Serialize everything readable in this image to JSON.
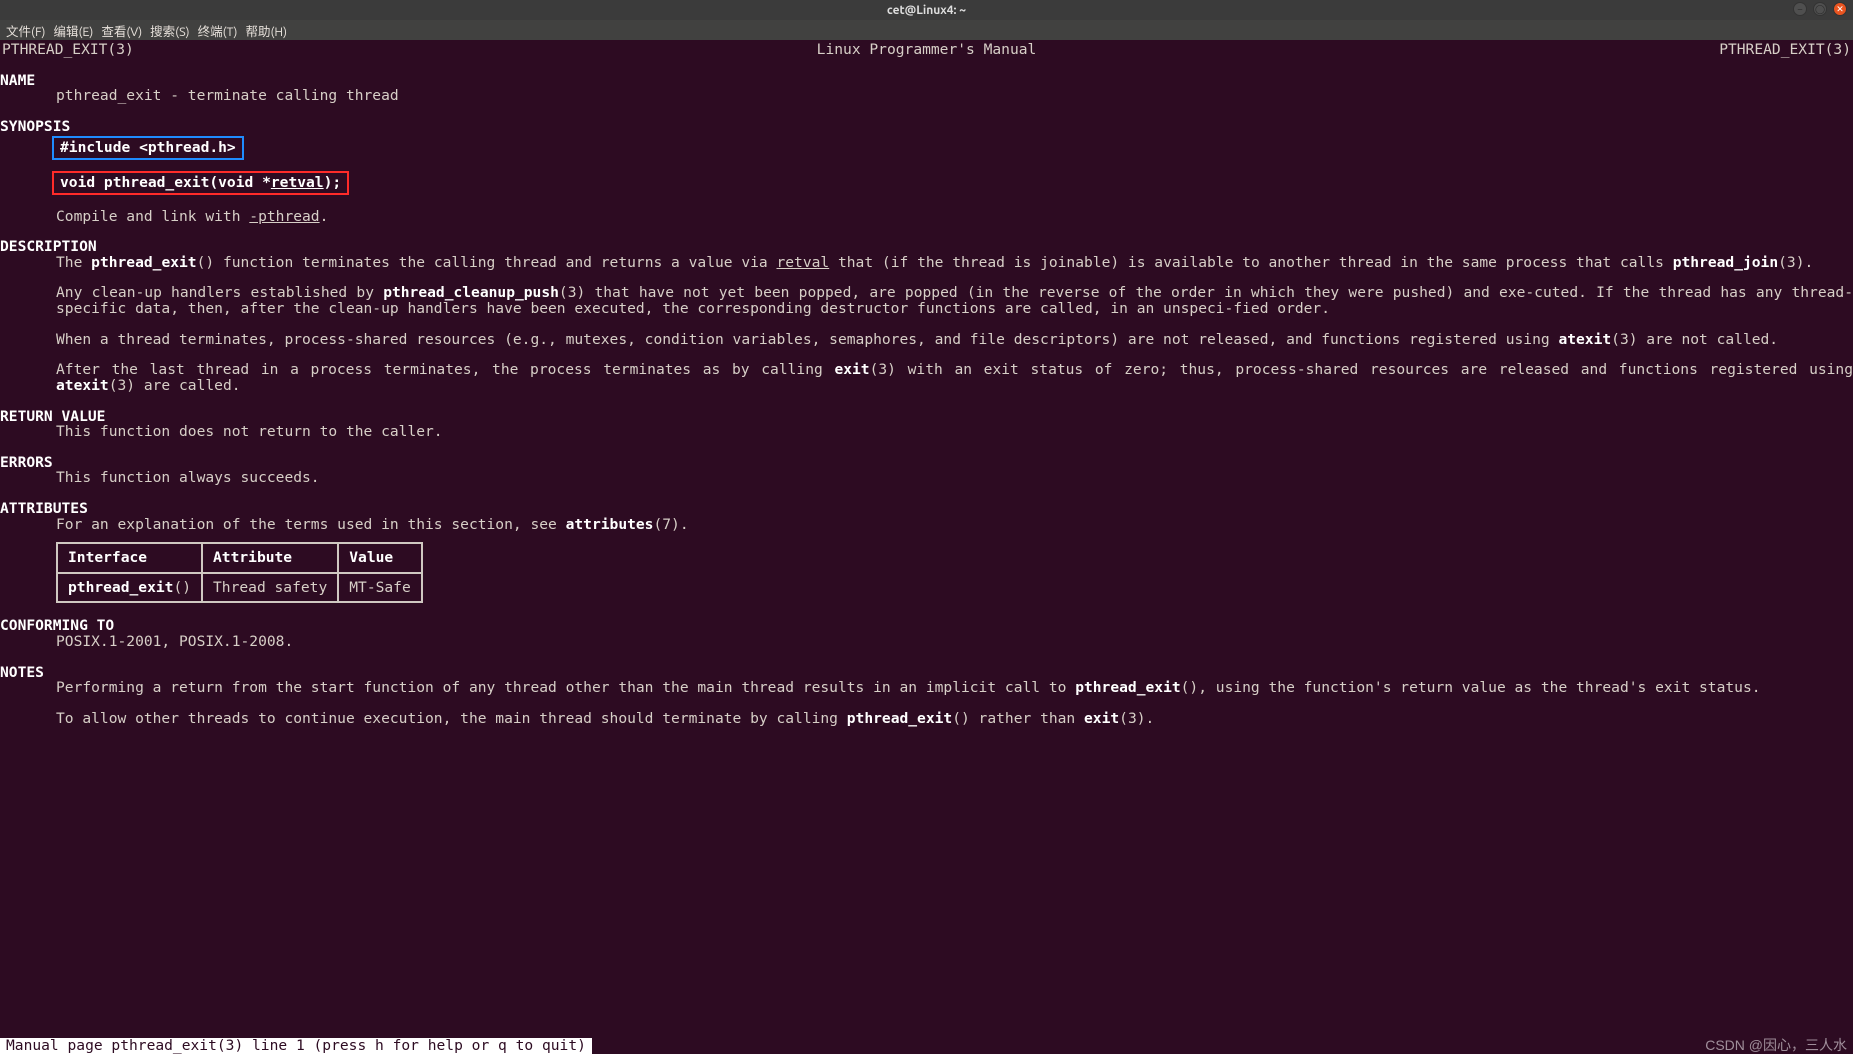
{
  "window": {
    "title": "cet@Linux4: ~"
  },
  "menu": {
    "file": "文件(F)",
    "edit": "编辑(E)",
    "view": "查看(V)",
    "search": "搜索(S)",
    "terminal": "终端(T)",
    "help": "帮助(H)"
  },
  "man": {
    "left": "PTHREAD_EXIT(3)",
    "center": "Linux Programmer's Manual",
    "right": "PTHREAD_EXIT(3)",
    "name_hdr": "NAME",
    "name_body": "pthread_exit - terminate calling thread",
    "synopsis_hdr": "SYNOPSIS",
    "include": "#include <pthread.h>",
    "proto_pre": "void pthread_exit(void *",
    "proto_arg": "retval",
    "proto_post": ");",
    "compile_pre": "Compile and link with ",
    "compile_flag": "-pthread",
    "compile_post": ".",
    "desc_hdr": "DESCRIPTION",
    "d1a": "The  ",
    "d1b": "pthread_exit",
    "d1c": "()  function  terminates  the  calling  thread  and returns a value via ",
    "d1d": "retval",
    "d1e": " that (if the thread is joinable) is available to another thread in the same process that calls ",
    "d1f": "pthread_join",
    "d1g": "(3).",
    "d2a": "Any clean-up handlers established by ",
    "d2b": "pthread_cleanup_push",
    "d2c": "(3) that have not yet been popped, are popped (in the reverse of the order in which they  were  pushed)  and  exe‐cuted.  If the thread has any thread-specific data, then, after the clean-up handlers have been executed, the corresponding destructor functions are called, in an unspeci‐fied order.",
    "d3a": "When a thread terminates, process-shared resources (e.g., mutexes, condition variables, semaphores, and file descriptors) are not released, and functions registered  using ",
    "d3b": "atexit",
    "d3c": "(3) are not called.",
    "d4a": "After  the  last  thread in a process terminates, the process terminates as by calling ",
    "d4b": "exit",
    "d4c": "(3) with an exit status of zero; thus, process-shared resources are released and functions registered using ",
    "d4d": "atexit",
    "d4e": "(3) are called.",
    "rv_hdr": "RETURN VALUE",
    "rv_body": "This function does not return to the caller.",
    "err_hdr": "ERRORS",
    "err_body": "This function always succeeds.",
    "attr_hdr": "ATTRIBUTES",
    "attr_lead_a": "For an explanation of the terms used in this section, see ",
    "attr_lead_b": "attributes",
    "attr_lead_c": "(7).",
    "tbl": {
      "h1": "Interface",
      "h2": "Attribute",
      "h3": "Value",
      "c1a": "pthread_exit",
      "c1b": "()",
      "c2": "Thread safety",
      "c3": "MT-Safe"
    },
    "conf_hdr": "CONFORMING TO",
    "conf_body": "POSIX.1-2001, POSIX.1-2008.",
    "notes_hdr": "NOTES",
    "n1a": "Performing a return from the start function of any thread other than the main thread results in an implicit call to ",
    "n1b": "pthread_exit",
    "n1c": "(), using the function's  return  value  as the thread's exit status.",
    "n2a": "To allow other threads to continue execution, the main thread should terminate by calling ",
    "n2b": "pthread_exit",
    "n2c": "() rather than ",
    "n2d": "exit",
    "n2e": "(3).",
    "status": " Manual page pthread_exit(3) line 1 (press h for help or q to quit)"
  },
  "watermark": "CSDN @因心，三人水"
}
